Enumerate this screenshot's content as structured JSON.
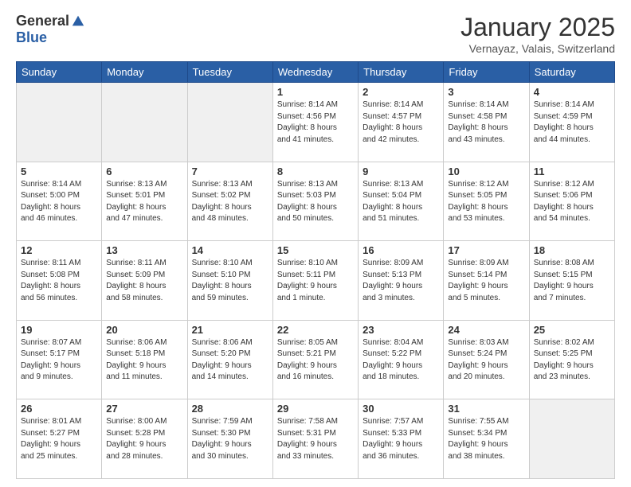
{
  "logo": {
    "general": "General",
    "blue": "Blue"
  },
  "header": {
    "month": "January 2025",
    "location": "Vernayaz, Valais, Switzerland"
  },
  "weekdays": [
    "Sunday",
    "Monday",
    "Tuesday",
    "Wednesday",
    "Thursday",
    "Friday",
    "Saturday"
  ],
  "weeks": [
    [
      {
        "day": "",
        "info": ""
      },
      {
        "day": "",
        "info": ""
      },
      {
        "day": "",
        "info": ""
      },
      {
        "day": "1",
        "info": "Sunrise: 8:14 AM\nSunset: 4:56 PM\nDaylight: 8 hours\nand 41 minutes."
      },
      {
        "day": "2",
        "info": "Sunrise: 8:14 AM\nSunset: 4:57 PM\nDaylight: 8 hours\nand 42 minutes."
      },
      {
        "day": "3",
        "info": "Sunrise: 8:14 AM\nSunset: 4:58 PM\nDaylight: 8 hours\nand 43 minutes."
      },
      {
        "day": "4",
        "info": "Sunrise: 8:14 AM\nSunset: 4:59 PM\nDaylight: 8 hours\nand 44 minutes."
      }
    ],
    [
      {
        "day": "5",
        "info": "Sunrise: 8:14 AM\nSunset: 5:00 PM\nDaylight: 8 hours\nand 46 minutes."
      },
      {
        "day": "6",
        "info": "Sunrise: 8:13 AM\nSunset: 5:01 PM\nDaylight: 8 hours\nand 47 minutes."
      },
      {
        "day": "7",
        "info": "Sunrise: 8:13 AM\nSunset: 5:02 PM\nDaylight: 8 hours\nand 48 minutes."
      },
      {
        "day": "8",
        "info": "Sunrise: 8:13 AM\nSunset: 5:03 PM\nDaylight: 8 hours\nand 50 minutes."
      },
      {
        "day": "9",
        "info": "Sunrise: 8:13 AM\nSunset: 5:04 PM\nDaylight: 8 hours\nand 51 minutes."
      },
      {
        "day": "10",
        "info": "Sunrise: 8:12 AM\nSunset: 5:05 PM\nDaylight: 8 hours\nand 53 minutes."
      },
      {
        "day": "11",
        "info": "Sunrise: 8:12 AM\nSunset: 5:06 PM\nDaylight: 8 hours\nand 54 minutes."
      }
    ],
    [
      {
        "day": "12",
        "info": "Sunrise: 8:11 AM\nSunset: 5:08 PM\nDaylight: 8 hours\nand 56 minutes."
      },
      {
        "day": "13",
        "info": "Sunrise: 8:11 AM\nSunset: 5:09 PM\nDaylight: 8 hours\nand 58 minutes."
      },
      {
        "day": "14",
        "info": "Sunrise: 8:10 AM\nSunset: 5:10 PM\nDaylight: 8 hours\nand 59 minutes."
      },
      {
        "day": "15",
        "info": "Sunrise: 8:10 AM\nSunset: 5:11 PM\nDaylight: 9 hours\nand 1 minute."
      },
      {
        "day": "16",
        "info": "Sunrise: 8:09 AM\nSunset: 5:13 PM\nDaylight: 9 hours\nand 3 minutes."
      },
      {
        "day": "17",
        "info": "Sunrise: 8:09 AM\nSunset: 5:14 PM\nDaylight: 9 hours\nand 5 minutes."
      },
      {
        "day": "18",
        "info": "Sunrise: 8:08 AM\nSunset: 5:15 PM\nDaylight: 9 hours\nand 7 minutes."
      }
    ],
    [
      {
        "day": "19",
        "info": "Sunrise: 8:07 AM\nSunset: 5:17 PM\nDaylight: 9 hours\nand 9 minutes."
      },
      {
        "day": "20",
        "info": "Sunrise: 8:06 AM\nSunset: 5:18 PM\nDaylight: 9 hours\nand 11 minutes."
      },
      {
        "day": "21",
        "info": "Sunrise: 8:06 AM\nSunset: 5:20 PM\nDaylight: 9 hours\nand 14 minutes."
      },
      {
        "day": "22",
        "info": "Sunrise: 8:05 AM\nSunset: 5:21 PM\nDaylight: 9 hours\nand 16 minutes."
      },
      {
        "day": "23",
        "info": "Sunrise: 8:04 AM\nSunset: 5:22 PM\nDaylight: 9 hours\nand 18 minutes."
      },
      {
        "day": "24",
        "info": "Sunrise: 8:03 AM\nSunset: 5:24 PM\nDaylight: 9 hours\nand 20 minutes."
      },
      {
        "day": "25",
        "info": "Sunrise: 8:02 AM\nSunset: 5:25 PM\nDaylight: 9 hours\nand 23 minutes."
      }
    ],
    [
      {
        "day": "26",
        "info": "Sunrise: 8:01 AM\nSunset: 5:27 PM\nDaylight: 9 hours\nand 25 minutes."
      },
      {
        "day": "27",
        "info": "Sunrise: 8:00 AM\nSunset: 5:28 PM\nDaylight: 9 hours\nand 28 minutes."
      },
      {
        "day": "28",
        "info": "Sunrise: 7:59 AM\nSunset: 5:30 PM\nDaylight: 9 hours\nand 30 minutes."
      },
      {
        "day": "29",
        "info": "Sunrise: 7:58 AM\nSunset: 5:31 PM\nDaylight: 9 hours\nand 33 minutes."
      },
      {
        "day": "30",
        "info": "Sunrise: 7:57 AM\nSunset: 5:33 PM\nDaylight: 9 hours\nand 36 minutes."
      },
      {
        "day": "31",
        "info": "Sunrise: 7:55 AM\nSunset: 5:34 PM\nDaylight: 9 hours\nand 38 minutes."
      },
      {
        "day": "",
        "info": ""
      }
    ]
  ]
}
